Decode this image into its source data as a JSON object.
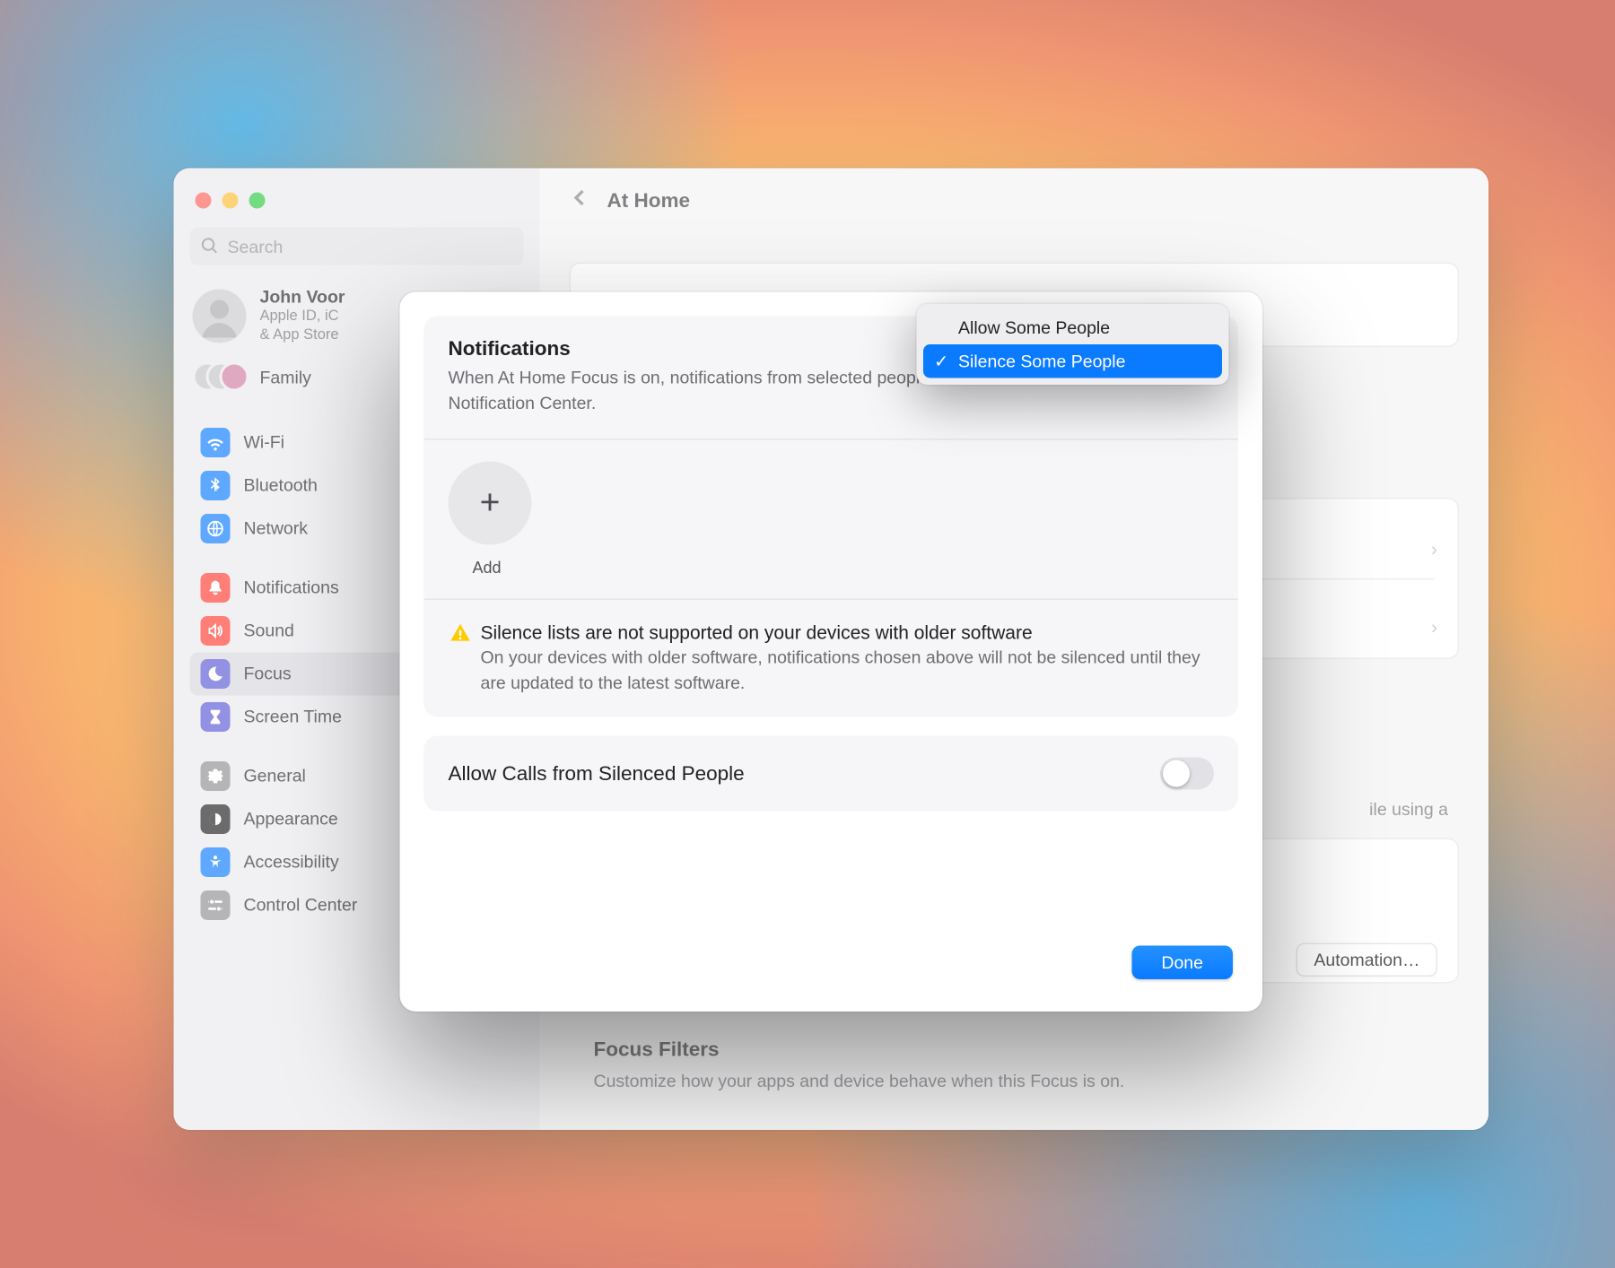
{
  "header": {
    "title": "At Home"
  },
  "search": {
    "placeholder": "Search"
  },
  "account": {
    "name": "John Voor",
    "subtitle1": "Apple ID, iC",
    "subtitle2": "& App Store"
  },
  "family_label": "Family",
  "sidebar": {
    "items": [
      {
        "label": "Wi-Fi"
      },
      {
        "label": "Bluetooth"
      },
      {
        "label": "Network"
      },
      {
        "label": "Notifications"
      },
      {
        "label": "Sound"
      },
      {
        "label": "Focus"
      },
      {
        "label": "Screen Time"
      },
      {
        "label": "General"
      },
      {
        "label": "Appearance"
      },
      {
        "label": "Accessibility"
      },
      {
        "label": "Control Center"
      }
    ]
  },
  "content_bg": {
    "desc_tail": "ile using a",
    "filters_title": "Focus Filters",
    "filters_sub": "Customize how your apps and device behave when this Focus is on.",
    "automation_btn": "Automation…"
  },
  "modal": {
    "title": "Notifications",
    "desc": "When At Home Focus is on, notifications from selected people will be silenced and sent to Notification Center.",
    "add_label": "Add",
    "warning_title": "Silence lists are not supported on your devices with older software",
    "warning_body": "On your devices with older software, notifications chosen above will not be silenced until they are updated to the latest software.",
    "toggle_label": "Allow Calls from Silenced People",
    "toggle_on": false,
    "done": "Done"
  },
  "dropdown": {
    "options": [
      {
        "label": "Allow Some People"
      },
      {
        "label": "Silence Some People"
      }
    ],
    "selected_index": 1
  }
}
